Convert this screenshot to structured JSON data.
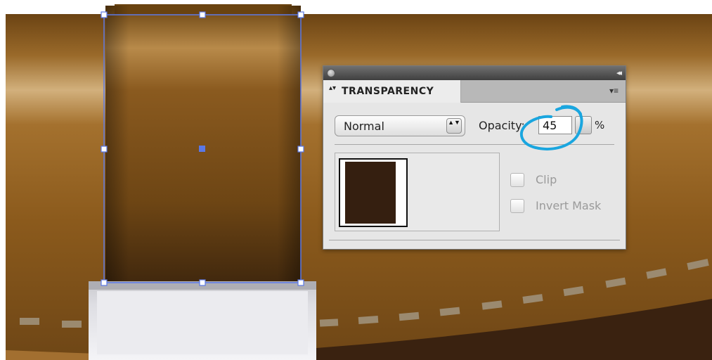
{
  "panel": {
    "title": "TRANSPARENCY",
    "tab_arrows": "▴▾",
    "collapse_glyph": "◂◂",
    "menu_glyph": "▾≡"
  },
  "blend_mode": {
    "value": "Normal",
    "stepper_glyph": "▲▼"
  },
  "opacity": {
    "label": "Opacity:",
    "value": "45",
    "unit": "%"
  },
  "options": {
    "clip_label": "Clip",
    "invert_mask_label": "Invert Mask",
    "clip_checked": false,
    "invert_mask_checked": false
  },
  "colors": {
    "panel_bg": "#e6e6e6",
    "selection": "#5b78e6",
    "annotation": "#1aa6df",
    "thumbnail_fill": "#351f10",
    "strap_brown": "#8a5a1f"
  }
}
